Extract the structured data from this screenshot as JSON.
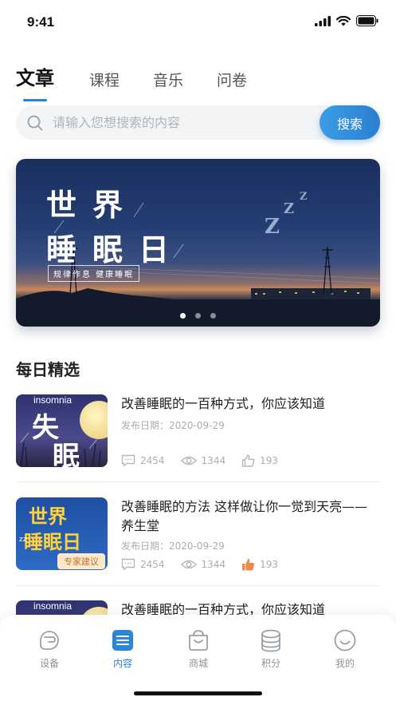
{
  "status": {
    "time": "9:41"
  },
  "tabs": [
    {
      "label": "文章",
      "active": true
    },
    {
      "label": "课程",
      "active": false
    },
    {
      "label": "音乐",
      "active": false
    },
    {
      "label": "问卷",
      "active": false
    }
  ],
  "search": {
    "placeholder": "请输入您想搜索的内容",
    "value": "",
    "button_label": "搜索"
  },
  "banner": {
    "title_line1": "世界",
    "title_line2": "睡眠日",
    "tagline": "规律作息 健康睡眠",
    "slides_count": 3,
    "active_slide": 1
  },
  "section": {
    "title": "每日精选"
  },
  "articles": [
    {
      "title": "改善睡眠的一百种方式，你应该知道",
      "date": "发布日期：2020-09-29",
      "comments": "2454",
      "views": "1344",
      "likes": "193",
      "liked": false,
      "thumb": {
        "small": "insomnia",
        "big1": "失",
        "big2": "眠"
      }
    },
    {
      "title": "改善睡眠的方法 这样做让你一觉到天亮——养生堂",
      "date": "发布日期：2020-09-29",
      "comments": "2454",
      "views": "1344",
      "likes": "193",
      "liked": true,
      "thumb": {
        "big1": "世界",
        "big2": "睡眠日",
        "badge": "专家建议",
        "zz": "zz"
      }
    },
    {
      "title": "改善睡眠的一百种方式，你应该知道",
      "thumb": {
        "small": "insomnia"
      }
    }
  ],
  "bottom_nav": [
    {
      "label": "设备",
      "icon": "device-icon",
      "active": false
    },
    {
      "label": "内容",
      "icon": "content-icon",
      "active": true
    },
    {
      "label": "商城",
      "icon": "shop-icon",
      "active": false
    },
    {
      "label": "积分",
      "icon": "points-icon",
      "active": false
    },
    {
      "label": "我的",
      "icon": "profile-icon",
      "active": false
    }
  ],
  "colors": {
    "accent": "#2a86d6",
    "liked": "#f08a4b",
    "muted": "#a9adb4"
  }
}
